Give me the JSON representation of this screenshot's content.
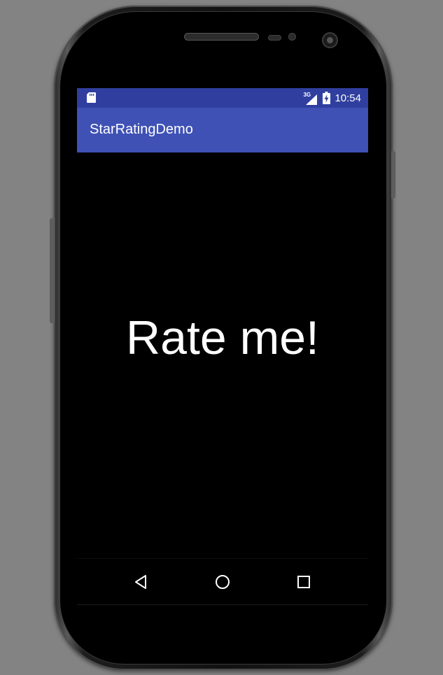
{
  "status_bar": {
    "network_label": "3G",
    "time": "10:54",
    "icons": [
      "sd-card-icon",
      "signal-3g-icon",
      "battery-charging-icon"
    ],
    "color": "#303F9F"
  },
  "app_bar": {
    "title": "StarRatingDemo",
    "color": "#3F51B5"
  },
  "main": {
    "prompt": "Rate me!"
  },
  "nav_bar": {
    "icons": [
      "back-icon",
      "home-icon",
      "recents-icon"
    ]
  },
  "device": {
    "background_color": "#838383"
  }
}
